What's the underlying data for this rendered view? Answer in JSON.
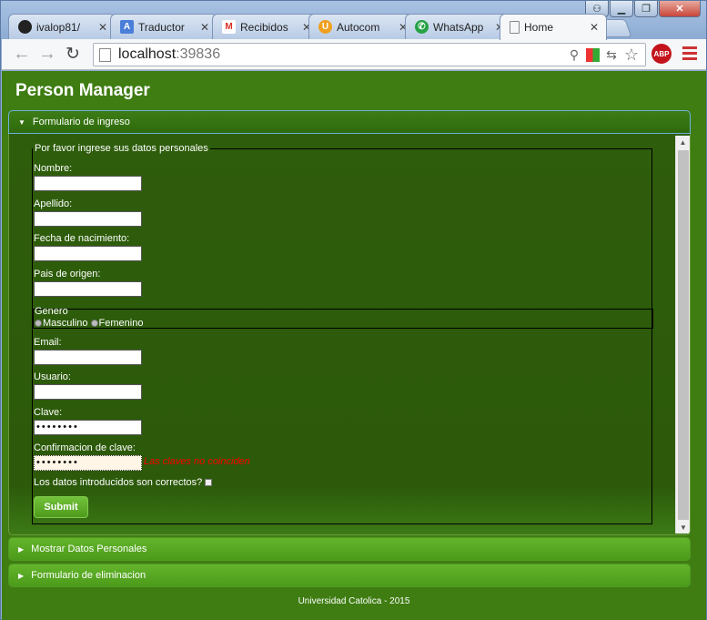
{
  "window": {
    "user_icon": "user-icon",
    "min": "▁",
    "max": "❐",
    "close": "✕"
  },
  "tabs": [
    {
      "title": "ivalop81/",
      "icon": "github-icon",
      "color": "#222222",
      "glyph": "●"
    },
    {
      "title": "Traductor",
      "icon": "translate-icon",
      "color": "#4a7fd9",
      "glyph": "A"
    },
    {
      "title": "Recibidos",
      "icon": "gmail-icon",
      "color": "#d93025",
      "glyph": "M"
    },
    {
      "title": "Autocom",
      "icon": "autocomplete-icon",
      "color": "#f0a020",
      "glyph": "U"
    },
    {
      "title": "WhatsApp",
      "icon": "whatsapp-icon",
      "color": "#25a244",
      "glyph": "✆"
    },
    {
      "title": "Home",
      "icon": "page-icon",
      "color": "#ffffff",
      "glyph": ""
    }
  ],
  "toolbar": {
    "back": "←",
    "forward": "→",
    "reload": "↻",
    "url_host": "localhost",
    "url_port": ":39836",
    "abp": "ABP"
  },
  "app": {
    "title": "Person Manager",
    "accordion": [
      {
        "label": "Formulario de ingreso",
        "expanded": true
      },
      {
        "label": "Mostrar Datos Personales",
        "expanded": false
      },
      {
        "label": "Formulario de eliminacion",
        "expanded": false
      }
    ],
    "form": {
      "legend": "Por favor ingrese sus datos personales",
      "nombre_label": "Nombre:",
      "apellido_label": "Apellido:",
      "fecha_label": "Fecha de nacimiento:",
      "pais_label": "Pais de origen:",
      "genero_legend": "Genero",
      "masculino": "Masculino",
      "femenino": "Femenino",
      "email_label": "Email:",
      "usuario_label": "Usuario:",
      "clave_label": "Clave:",
      "clave_value": "••••••••",
      "confirm_label": "Confirmacion de clave:",
      "confirm_value": "••••••••",
      "error": "Las claves no coinciden",
      "check_label": "Los datos introducidos son correctos?",
      "submit": "Submit"
    },
    "footer": "Universidad Catolica - 2015"
  }
}
